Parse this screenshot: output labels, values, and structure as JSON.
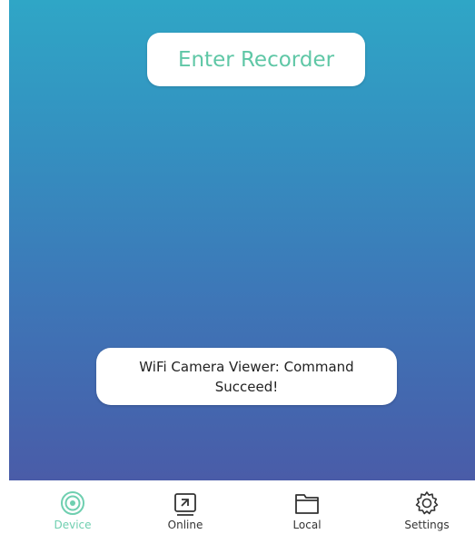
{
  "main": {
    "enter_recorder_label": "Enter Recorder"
  },
  "toast": {
    "message": "WiFi Camera Viewer: Command Succeed!"
  },
  "tab_bar": {
    "tabs": [
      {
        "label": "Device",
        "icon": "camera-lens-icon",
        "active": true
      },
      {
        "label": "Online",
        "icon": "online-arrow-icon",
        "active": false
      },
      {
        "label": "Local",
        "icon": "folder-icon",
        "active": false
      },
      {
        "label": "Settings",
        "icon": "gear-icon",
        "active": false
      }
    ]
  },
  "colors": {
    "accent": "#5fc7a6",
    "gradient_top": "#2fa6c6",
    "gradient_bottom": "#4a5ca8"
  }
}
